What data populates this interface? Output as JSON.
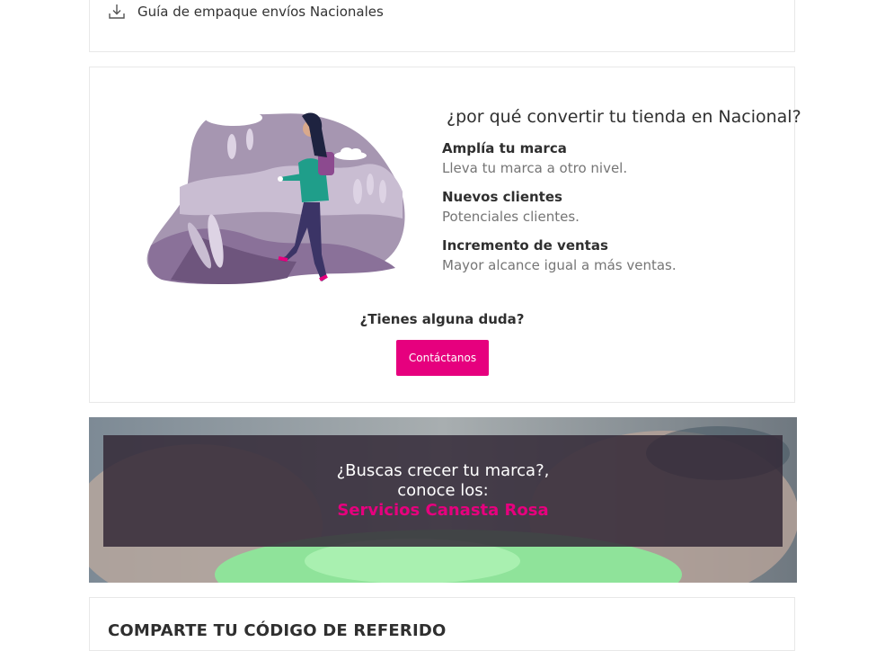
{
  "download": {
    "label": "Guía de empaque envíos Nacionales",
    "icon": "download-icon"
  },
  "info": {
    "heading": "¿por qué convertir tu tienda en Nacional?",
    "benefits": [
      {
        "title": "Amplía tu marca",
        "description": "Lleva tu marca a otro nivel."
      },
      {
        "title": "Nuevos clientes",
        "description": "Potenciales clientes."
      },
      {
        "title": "Incremento de ventas",
        "description": "Mayor alcance igual a más ventas."
      }
    ],
    "question": "¿Tienes alguna duda?",
    "contact_label": "Contáctanos"
  },
  "banner": {
    "line1": "¿Buscas crecer tu marca?,",
    "line2": "conoce los:",
    "link": "Servicios Canasta Rosa"
  },
  "referral": {
    "title": "COMPARTE TU CÓDIGO DE REFERIDO"
  },
  "colors": {
    "brand_pink": "#e6007e",
    "illustration_purple": "#8a7199",
    "text_dark": "#2f2f2f",
    "text_muted": "#757575"
  }
}
